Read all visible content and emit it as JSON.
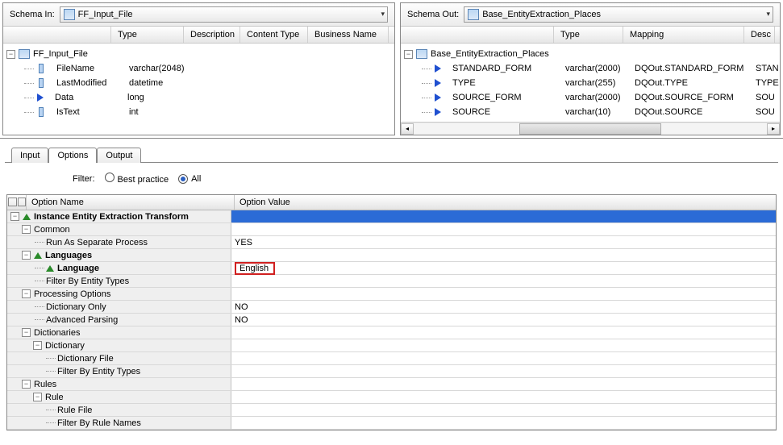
{
  "schema_in": {
    "label": "Schema In:",
    "value": "FF_Input_File"
  },
  "schema_out": {
    "label": "Schema Out:",
    "value": "Base_EntityExtraction_Places"
  },
  "left_headers": {
    "blank": "",
    "type": "Type",
    "desc": "Description",
    "ct": "Content Type",
    "bn": "Business Name"
  },
  "right_headers": {
    "blank": "",
    "type": "Type",
    "map": "Mapping",
    "desc": "Desc"
  },
  "left_tree": {
    "root": "FF_Input_File",
    "cols": [
      {
        "name": "FileName",
        "type": "varchar(2048)",
        "icon": "col"
      },
      {
        "name": "LastModified",
        "type": "datetime",
        "icon": "col"
      },
      {
        "name": "Data",
        "type": "long",
        "icon": "arrow"
      },
      {
        "name": "IsText",
        "type": "int",
        "icon": "col"
      }
    ]
  },
  "right_tree": {
    "root": "Base_EntityExtraction_Places",
    "cols": [
      {
        "name": "STANDARD_FORM",
        "type": "varchar(2000)",
        "map": "DQOut.STANDARD_FORM",
        "desc": "STAN"
      },
      {
        "name": "TYPE",
        "type": "varchar(255)",
        "map": "DQOut.TYPE",
        "desc": "TYPE"
      },
      {
        "name": "SOURCE_FORM",
        "type": "varchar(2000)",
        "map": "DQOut.SOURCE_FORM",
        "desc": "SOU"
      },
      {
        "name": "SOURCE",
        "type": "varchar(10)",
        "map": "DQOut.SOURCE",
        "desc": "SOU"
      }
    ]
  },
  "tabs": {
    "input": "Input",
    "options": "Options",
    "output": "Output"
  },
  "filter": {
    "label": "Filter:",
    "best": "Best practice",
    "all": "All"
  },
  "opt_headers": {
    "name": "Option Name",
    "value": "Option Value"
  },
  "opts": {
    "root": "Instance Entity Extraction Transform",
    "common": "Common",
    "run_as": "Run As Separate Process",
    "run_as_v": "YES",
    "languages": "Languages",
    "language": "Language",
    "language_v": "English",
    "filter_entity": "Filter By Entity Types",
    "proc": "Processing Options",
    "dict_only": "Dictionary Only",
    "dict_only_v": "NO",
    "adv_parse": "Advanced Parsing",
    "adv_parse_v": "NO",
    "dicts": "Dictionaries",
    "dict": "Dictionary",
    "dict_file": "Dictionary File",
    "filter_entity2": "Filter By Entity Types",
    "rules": "Rules",
    "rule": "Rule",
    "rule_file": "Rule File",
    "filter_rule": "Filter By Rule Names"
  }
}
